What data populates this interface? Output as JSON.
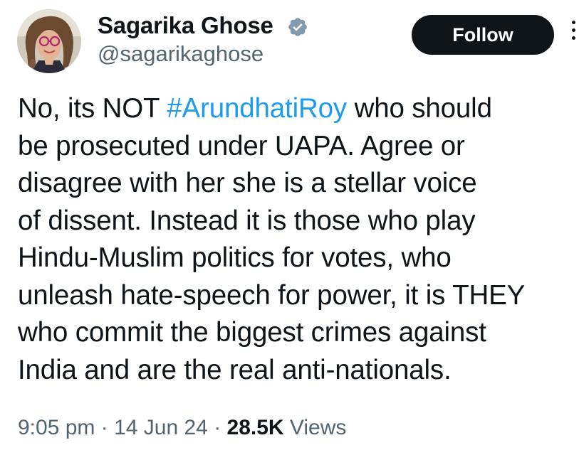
{
  "author": {
    "display_name": "Sagarika Ghose",
    "handle": "@sagarikaghose",
    "verified": true,
    "avatar": "profile-photo"
  },
  "actions": {
    "follow_label": "Follow",
    "more_icon": "more-options-icon"
  },
  "tweet": {
    "lines": [
      {
        "before": "No, its NOT ",
        "hashtag": "#ArundhatiRoy",
        "after": " who should"
      },
      "be prosecuted under UAPA. Agree or",
      "disagree with her she is a stellar voice",
      "of dissent. Instead it is those who play",
      "Hindu-Muslim politics for votes, who",
      "unleash hate-speech for power, it is THEY",
      "who commit the biggest crimes against",
      "India and are the real anti-nationals."
    ]
  },
  "meta": {
    "time": "9:05 pm",
    "separator": " · ",
    "date": "14 Jun 24",
    "views_count": "28.5K",
    "views_label": " Views"
  },
  "colors": {
    "text": "#0f1419",
    "secondary": "#536471",
    "link": "#1d9bf0",
    "verified_badge": "#829aab",
    "follow_bg": "#0f1419"
  }
}
